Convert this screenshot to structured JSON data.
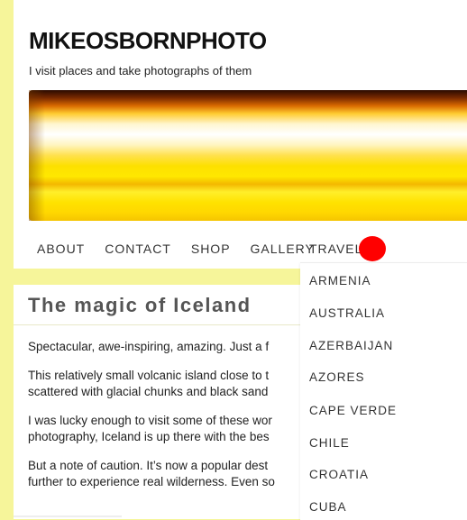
{
  "site": {
    "title": "MIKEOSBORNPHOTO",
    "tagline": "I visit places and take photographs of them"
  },
  "banner": {
    "description_colors": [
      "#7a2a00",
      "#ffffff",
      "#ffe200"
    ]
  },
  "nav": {
    "items": [
      {
        "label": "ABOUT"
      },
      {
        "label": "CONTACT"
      },
      {
        "label": "SHOP"
      },
      {
        "label": "GALLERY"
      }
    ],
    "travel_label": "TRAVEL"
  },
  "dropdown": {
    "items": [
      {
        "label": "ARMENIA"
      },
      {
        "label": "AUSTRALIA"
      },
      {
        "label": "AZERBAIJAN"
      },
      {
        "label": "AZORES"
      },
      {
        "label": "CAPE VERDE"
      },
      {
        "label": "CHILE"
      },
      {
        "label": "CROATIA"
      },
      {
        "label": "CUBA"
      }
    ]
  },
  "post": {
    "title": "The magic of Iceland",
    "paragraphs": [
      [
        "Spectacular, awe-inspiring, amazing. Just a f"
      ],
      [
        "This relatively small volcanic island close to t",
        "scattered with glacial chunks and black sand"
      ],
      [
        "I was lucky enough to visit some of these wor",
        "photography, Iceland is up there with the bes"
      ],
      [
        "But a note of caution. It’s now a popular dest",
        "further to experience real wilderness. Even so"
      ]
    ]
  },
  "colors": {
    "page_background": "#f6f59a",
    "content_background": "#ffffff",
    "pointer_dot": "#ff0000"
  }
}
